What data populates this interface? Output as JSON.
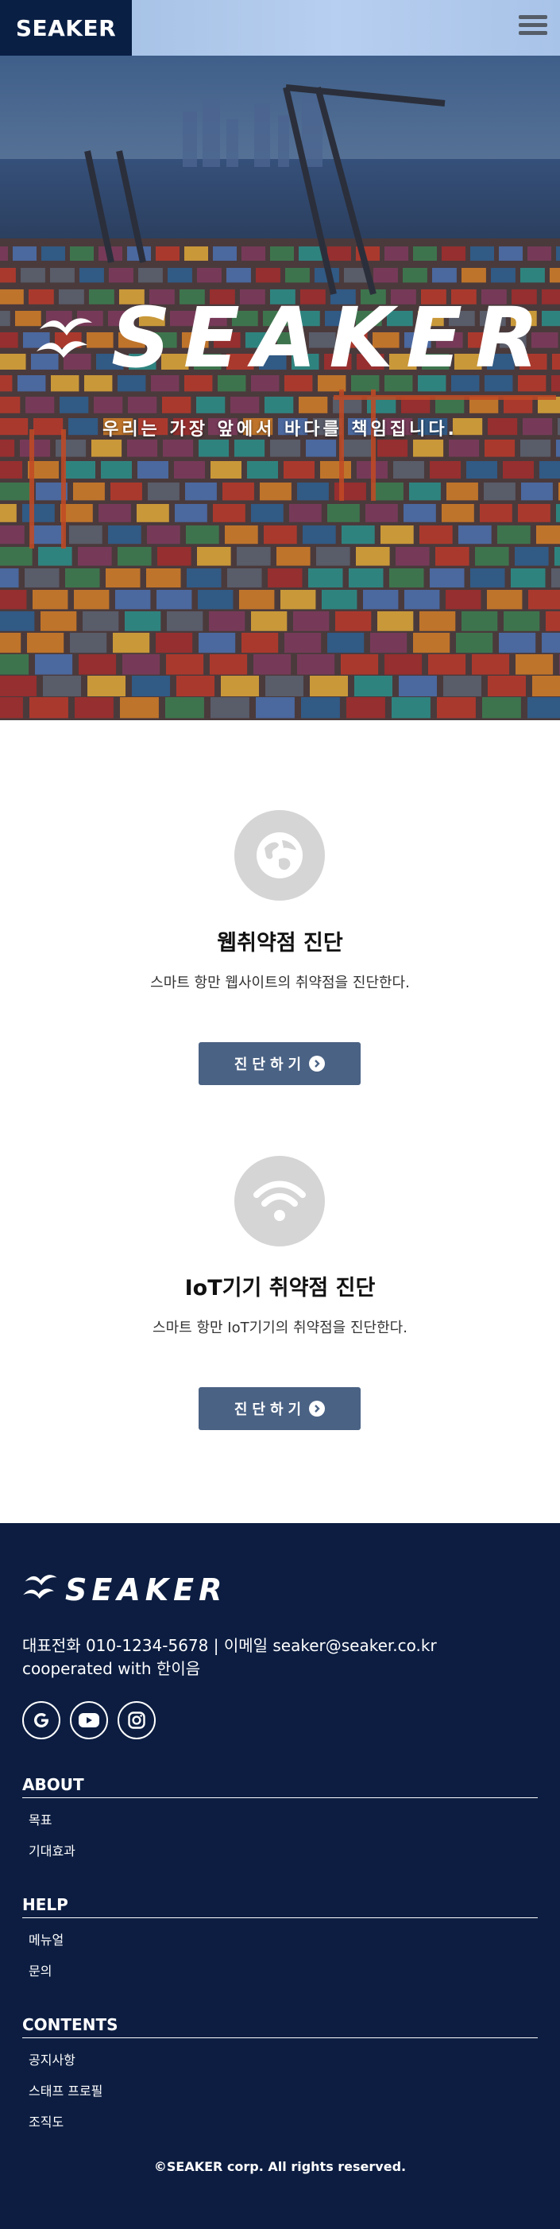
{
  "header": {
    "logo": "SEAKER",
    "menu_icon": "hamburger-menu-icon"
  },
  "hero": {
    "brand": "SEAKER",
    "tagline": "우리는 가장 앞에서 바다를 책임집니다.",
    "logo_icon": "seagull-icon"
  },
  "services": [
    {
      "icon": "globe-icon",
      "title": "웹취약점 진단",
      "description": "스마트 항만 웹사이트의 취약점을 진단한다.",
      "button_label": "진단하기",
      "button_icon": "chevron-right-circle-icon"
    },
    {
      "icon": "wifi-icon",
      "title": "IoT기기 취약점 진단",
      "description": "스마트 항만 IoT기기의 취약점을 진단한다.",
      "button_label": "진단하기",
      "button_icon": "chevron-right-circle-icon"
    }
  ],
  "footer": {
    "logo": "SEAKER",
    "contact_line": "대표전화 010-1234-5678 | 이메일 seaker@seaker.co.kr",
    "cooperation": "cooperated with 한이음",
    "social": [
      "google-icon",
      "youtube-icon",
      "instagram-icon"
    ],
    "sections": [
      {
        "title": "ABOUT",
        "items": [
          "목표",
          "기대효과"
        ]
      },
      {
        "title": "HELP",
        "items": [
          "메뉴얼",
          "문의"
        ]
      },
      {
        "title": "CONTENTS",
        "items": [
          "공지사항",
          "스태프 프로필",
          "조직도"
        ]
      }
    ],
    "copyright": "©SEAKER corp. All rights reserved."
  },
  "colors": {
    "navy": "#0c1d41",
    "header_logo_bg": "#0a1f44",
    "button": "#4a6284",
    "icon_circle": "#d5d5d5"
  }
}
